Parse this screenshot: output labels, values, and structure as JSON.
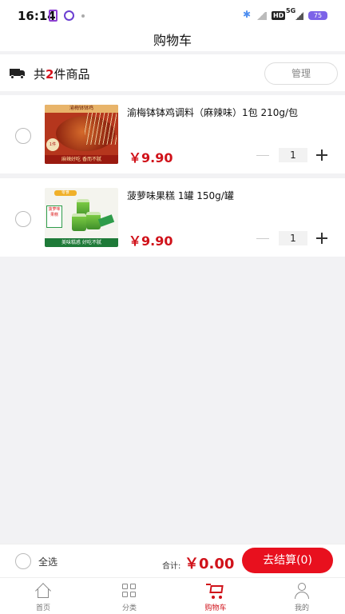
{
  "status_bar": {
    "time": "16:14",
    "battery": "75",
    "network": "5G"
  },
  "header": {
    "title": "购物车"
  },
  "summary": {
    "prefix": "共",
    "count": "2",
    "suffix": "件商品",
    "manage_label": "管理"
  },
  "cart_items": [
    {
      "title": "渝梅钵钵鸡调料（麻辣味）1包 210g/包",
      "price": "￥9.90",
      "quantity": "1",
      "thumb_text": {
        "head": "渝梅钵钵鸡",
        "badge": "1件",
        "strip": "麻辣好吃 香而不腻"
      }
    },
    {
      "title": "菠萝味果糕 1罐 150g/罐",
      "price": "￥9.90",
      "quantity": "1",
      "thumb_text": {
        "logo": "零食",
        "side": "菠萝味果糕",
        "strip": "美味糕惑 好吃不腻"
      }
    }
  ],
  "checkout": {
    "select_all_label": "全选",
    "total_label": "合计:",
    "total_value": "￥0.00",
    "checkout_label": "去结算(0)"
  },
  "tabbar": {
    "tabs": [
      {
        "label": "首页",
        "icon": "home-icon"
      },
      {
        "label": "分类",
        "icon": "grid-icon"
      },
      {
        "label": "购物车",
        "icon": "cart-icon",
        "active": true
      },
      {
        "label": "我的",
        "icon": "user-icon"
      }
    ]
  },
  "colors": {
    "accent": "#d0121a",
    "checkout_button": "#e8101e",
    "background": "#f2f2f4"
  }
}
